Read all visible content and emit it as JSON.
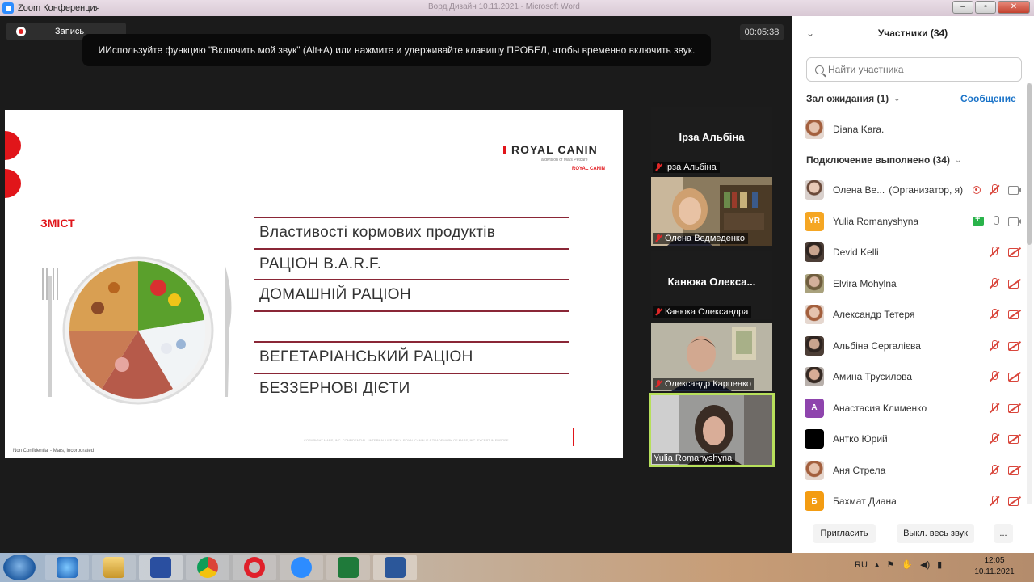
{
  "window": {
    "title": "Zoom Конференция",
    "ghost_title": "Ворд Дизайн 10.11.2021 - Microsoft Word"
  },
  "meeting": {
    "record_label": "Запись",
    "timer": "00:05:38",
    "toast": "ИИспользуйте функцию \"Включить мой звук\" (Alt+A) или нажмите и удерживайте клавишу ПРОБЕЛ, чтобы временно включить звук."
  },
  "slide": {
    "logo": "ROYAL CANIN",
    "logo_sub": "a division of Mars Petcare",
    "logo_crown": "ROYAL CANIN",
    "heading": "ЗМІСТ",
    "toc": [
      "Властивості кормових продуктів",
      "РАЦІОН B.A.R.F.",
      "ДОМАШНІЙ РАЦІОН",
      "",
      "ВЕГЕТАРІАНСЬКИЙ РАЦІОН",
      "БЕЗЗЕРНОВІ ДІЄТИ"
    ],
    "footer_left": "Non Confidential - Mars, Incorporated",
    "footer_right": "COPYRIGHT MARS, INC. CONFIDENTIAL - INTERNAL USE ONLY. ROYAL CANIN IS A TRADEMARK OF MARS, INC. EXCEPT IN EUROPE"
  },
  "videos": [
    {
      "big_name": "Ірза Альбіна",
      "label": "Ірза Альбіна",
      "muted": true,
      "video": false
    },
    {
      "big_name": "",
      "label": "Олена Ведмеденко",
      "muted": true,
      "video": true
    },
    {
      "big_name": "Канюка Олекса...",
      "label": "Канюка Олександра",
      "muted": true,
      "video": false
    },
    {
      "big_name": "",
      "label": "Олександр Карпенко",
      "muted": true,
      "video": true
    },
    {
      "big_name": "",
      "label": "Yulia Romanyshyna",
      "muted": false,
      "video": true,
      "active": true
    }
  ],
  "participants_panel": {
    "title": "Участники (34)",
    "search_placeholder": "Найти участника",
    "waiting_label": "Зал ожидания (1)",
    "message_link": "Сообщение",
    "waiting": [
      {
        "name": "Diana Kara."
      }
    ],
    "connected_label": "Подключение выполнено (34)",
    "list": [
      {
        "name": "Олена Ве...",
        "role": "(Организатор, я)",
        "avatar": "photo",
        "icons": [
          "record",
          "mic-muted",
          "cam"
        ]
      },
      {
        "name": "Yulia Romanyshyna",
        "role": "",
        "avatar": "initials",
        "initials": "YR",
        "color": "#f5a623",
        "icons": [
          "share",
          "mic",
          "cam"
        ]
      },
      {
        "name": "Devid Kelli",
        "role": "",
        "avatar": "photo2",
        "icons": [
          "mic-muted",
          "cam-off"
        ]
      },
      {
        "name": "Elvira Mohylna",
        "role": "",
        "avatar": "photo3",
        "icons": [
          "mic-muted",
          "cam-off"
        ]
      },
      {
        "name": "Александр Тетеря",
        "role": "",
        "avatar": "photo5",
        "icons": [
          "mic-muted",
          "cam-off"
        ]
      },
      {
        "name": "Альбіна Сергалієва",
        "role": "",
        "avatar": "photo2",
        "icons": [
          "mic-muted",
          "cam-off"
        ]
      },
      {
        "name": "Амина Трусилова",
        "role": "",
        "avatar": "photo4",
        "icons": [
          "mic-muted",
          "cam-off"
        ]
      },
      {
        "name": "Анастасия Клименко",
        "role": "",
        "avatar": "initials",
        "initials": "А",
        "color": "#8e44ad",
        "icons": [
          "mic-muted",
          "cam-off"
        ]
      },
      {
        "name": "Антко Юрий",
        "role": "",
        "avatar": "black",
        "icons": [
          "mic-muted",
          "cam-off"
        ]
      },
      {
        "name": "Аня Стрела",
        "role": "",
        "avatar": "photo5",
        "icons": [
          "mic-muted",
          "cam-off"
        ]
      },
      {
        "name": "Бахмат Диана",
        "role": "",
        "avatar": "initials",
        "initials": "Б",
        "color": "#f39c12",
        "icons": [
          "mic-muted",
          "cam-off"
        ]
      }
    ],
    "footer": {
      "invite": "Пригласить",
      "mute_all": "Выкл. весь звук",
      "more": "..."
    }
  },
  "taskbar": {
    "apps": [
      "ie-icon",
      "folder-icon",
      "save-icon",
      "chrome-icon",
      "opera-icon",
      "zoom-icon",
      "excel-icon",
      "word-icon"
    ],
    "lang": "RU",
    "time": "12:05",
    "date": "10.11.2021"
  },
  "colors": {
    "brand_red": "#e1151a",
    "zoom_blue": "#2d8cff",
    "link_blue": "#1a73c8",
    "active_border": "#b7e05b"
  }
}
